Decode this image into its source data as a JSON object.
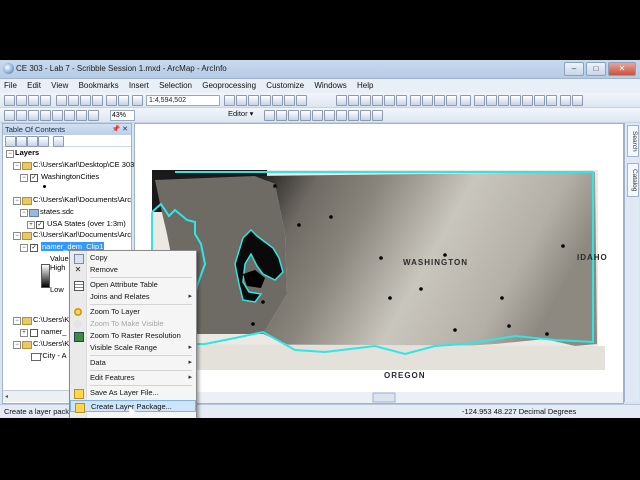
{
  "window": {
    "title": "CE 303 - Lab 7 - Scribble Session 1.mxd - ArcMap - ArcInfo",
    "min": "–",
    "max": "□",
    "close": "✕"
  },
  "menu": [
    "File",
    "Edit",
    "View",
    "Bookmarks",
    "Insert",
    "Selection",
    "Geoprocessing",
    "Customize",
    "Windows",
    "Help"
  ],
  "toolbar": {
    "scale": "1:4,594,502",
    "editor": "Editor ▾",
    "zoom_percent": "43%"
  },
  "toc": {
    "title": "Table Of Contents",
    "pin": "📌 ✕",
    "items": [
      {
        "label": "Layers"
      },
      {
        "label": "C:\\Users\\Karl\\Desktop\\CE 303"
      },
      {
        "label": "WashingtonCities"
      },
      {
        "label": "C:\\Users\\Karl\\Documents\\Arc"
      },
      {
        "label": "states.sdc"
      },
      {
        "label": "USA States (over 1:3m)"
      },
      {
        "label": "C:\\Users\\Karl\\Documents\\Arc"
      },
      {
        "label": "namer_dem_Clip1"
      },
      {
        "label": "Value"
      },
      {
        "label": "High"
      },
      {
        "label": "Low"
      },
      {
        "label": "C:\\Users\\K"
      },
      {
        "label": "namer_"
      },
      {
        "label": "C:\\Users\\K"
      },
      {
        "label": "'City - A"
      }
    ]
  },
  "map": {
    "labels": {
      "washington": "WASHINGTON",
      "idaho": "IDAHO",
      "oregon": "OREGON"
    }
  },
  "context_menu": {
    "items": [
      {
        "label": "Copy",
        "enabled": true
      },
      {
        "label": "Remove",
        "enabled": true
      },
      {
        "label": "Open Attribute Table",
        "enabled": true
      },
      {
        "label": "Joins and Relates",
        "enabled": true
      },
      {
        "label": "Zoom To Layer",
        "enabled": true
      },
      {
        "label": "Zoom To Make Visible",
        "enabled": false
      },
      {
        "label": "Zoom To Raster Resolution",
        "enabled": true
      },
      {
        "label": "Visible Scale Range",
        "enabled": true
      },
      {
        "label": "Data",
        "enabled": true
      },
      {
        "label": "Edit Features",
        "enabled": true
      },
      {
        "label": "Save As Layer File...",
        "enabled": true
      },
      {
        "label": "Create Layer Package...",
        "enabled": true,
        "highlighted": true
      }
    ]
  },
  "statusbar": {
    "left": "Create a layer pack",
    "coords": "-124.953  48.227 Decimal Degrees"
  },
  "rightbar": {
    "search": "Search",
    "catalog": "Catalog"
  }
}
